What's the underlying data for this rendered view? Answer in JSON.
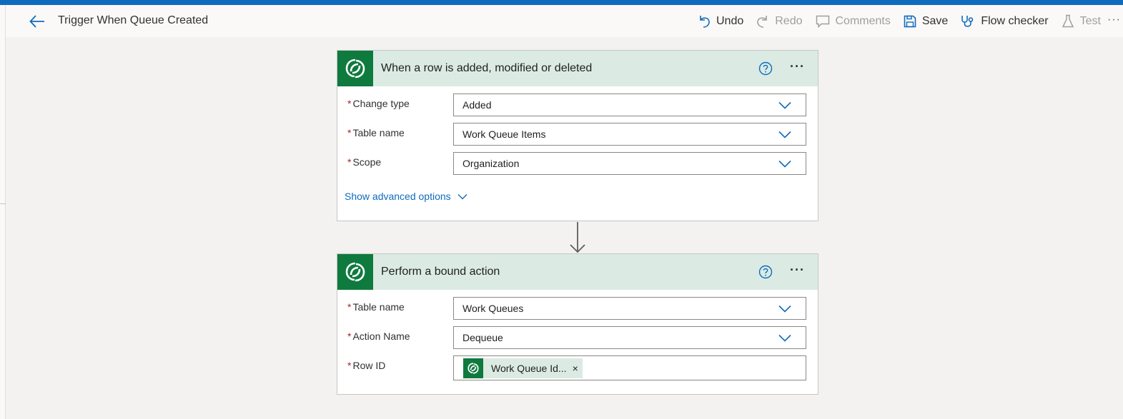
{
  "header": {
    "title": "Trigger When Queue Created",
    "back_icon": "arrow-left-icon"
  },
  "toolbar": {
    "undo": "Undo",
    "redo": "Redo",
    "comments": "Comments",
    "save": "Save",
    "flow_checker": "Flow checker",
    "test": "Test",
    "more": "···"
  },
  "colors": {
    "accent": "#0f6cbd",
    "dataverse_green": "#0e7a3e",
    "card_header_bg": "#dbebe3",
    "required": "#a4262c"
  },
  "trigger_card": {
    "title": "When a row is added, modified or deleted",
    "icon": "dataverse-icon",
    "more": "···",
    "fields": [
      {
        "label": "Change type",
        "value": "Added",
        "required": "*"
      },
      {
        "label": "Table name",
        "value": "Work Queue Items",
        "required": "*"
      },
      {
        "label": "Scope",
        "value": "Organization",
        "required": "*"
      }
    ],
    "advanced_link": "Show advanced options"
  },
  "action_card": {
    "title": "Perform a bound action",
    "icon": "dataverse-icon",
    "more": "···",
    "fields": [
      {
        "label": "Table name",
        "value": "Work Queues",
        "required": "*"
      },
      {
        "label": "Action Name",
        "value": "Dequeue",
        "required": "*"
      },
      {
        "label": "Row ID",
        "required": "*",
        "token": {
          "label": "Work Queue Id...",
          "remove": "×"
        }
      }
    ]
  }
}
